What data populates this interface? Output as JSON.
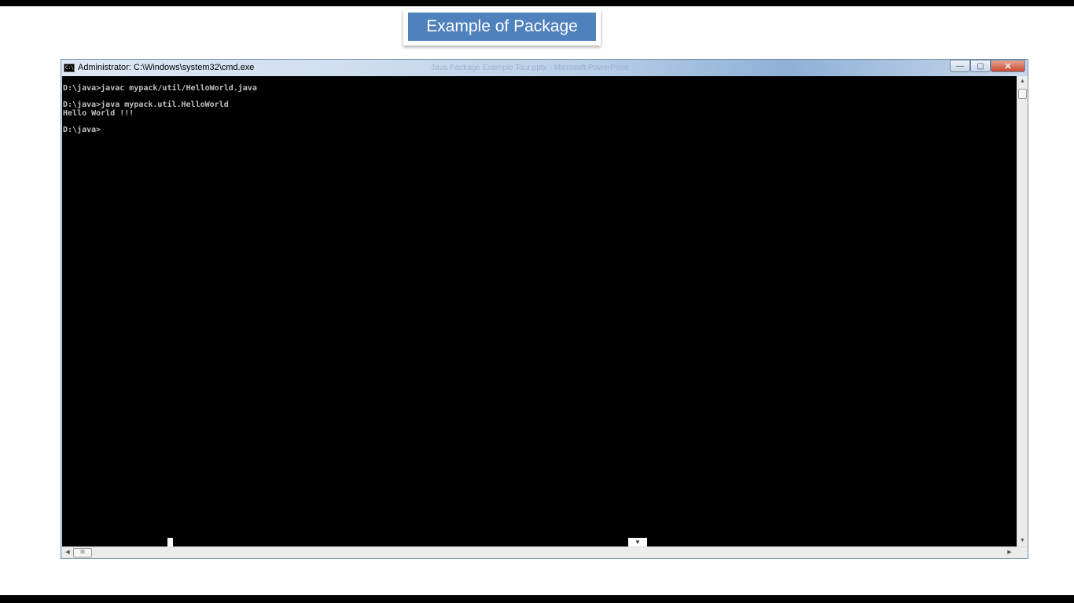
{
  "slide": {
    "title": "Example of Package"
  },
  "window": {
    "title": "Administrator: C:\\Windows\\system32\\cmd.exe",
    "icon": "cmd-icon",
    "icon_text": "C:\\",
    "ghost_title": "Java Package Example Tour.pptx - Microsoft PowerPoint",
    "buttons": {
      "minimize": "—",
      "maximize": "▢",
      "close": "✕"
    }
  },
  "console": {
    "lines": [
      "D:\\java>javac mypack/util/HelloWorld.java",
      "",
      "D:\\java>java mypack.util.HelloWorld",
      "Hello World !!!",
      "",
      "D:\\java>"
    ]
  },
  "scrollbars": {
    "up": "▲",
    "down": "▼",
    "left": "◀",
    "right": "▶",
    "h_thumb_grip": "III"
  },
  "colors": {
    "accent": "#4f81bd",
    "console_bg": "#000000",
    "console_fg": "#c0c0c0"
  }
}
